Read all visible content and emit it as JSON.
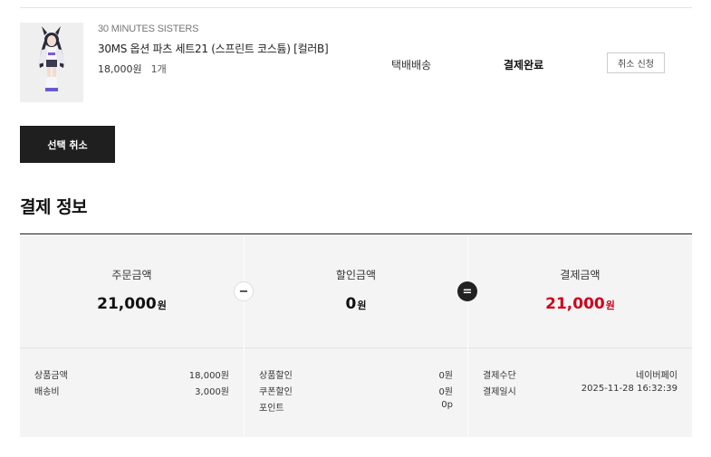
{
  "product": {
    "brand": "30 MINUTES SISTERS",
    "name": "30MS 옵션 파츠 세트21 (스프린트 코스튬) [컬러B]",
    "price": "18,000원",
    "quantity": "1개",
    "shipping_method": "택배배송",
    "status": "결제완료",
    "cancel_request_label": "취소 신청"
  },
  "select_cancel_label": "선택 취소",
  "payment_section": {
    "title": "결제 정보",
    "order_amount": {
      "label": "주문금액",
      "value": "21,000",
      "unit": "원"
    },
    "discount_amount": {
      "label": "할인금액",
      "value": "0",
      "unit": "원"
    },
    "payment_amount": {
      "label": "결제금액",
      "value": "21,000",
      "unit": "원",
      "color": "#d0021b"
    },
    "operators": {
      "minus": "−",
      "equals": "="
    },
    "order_details": [
      {
        "label": "상품금액",
        "value": "18,000원"
      },
      {
        "label": "배송비",
        "value": "3,000원"
      }
    ],
    "discount_details": [
      {
        "label": "상품할인",
        "value": "0원"
      },
      {
        "label": "쿠폰할인",
        "value": "0원"
      },
      {
        "label": "포인트",
        "value": "0p"
      }
    ],
    "payment_details": [
      {
        "label": "결제수단",
        "value": "네이버페이"
      },
      {
        "label": "결제일시",
        "value": "2025-11-28 16:32:39"
      }
    ]
  }
}
